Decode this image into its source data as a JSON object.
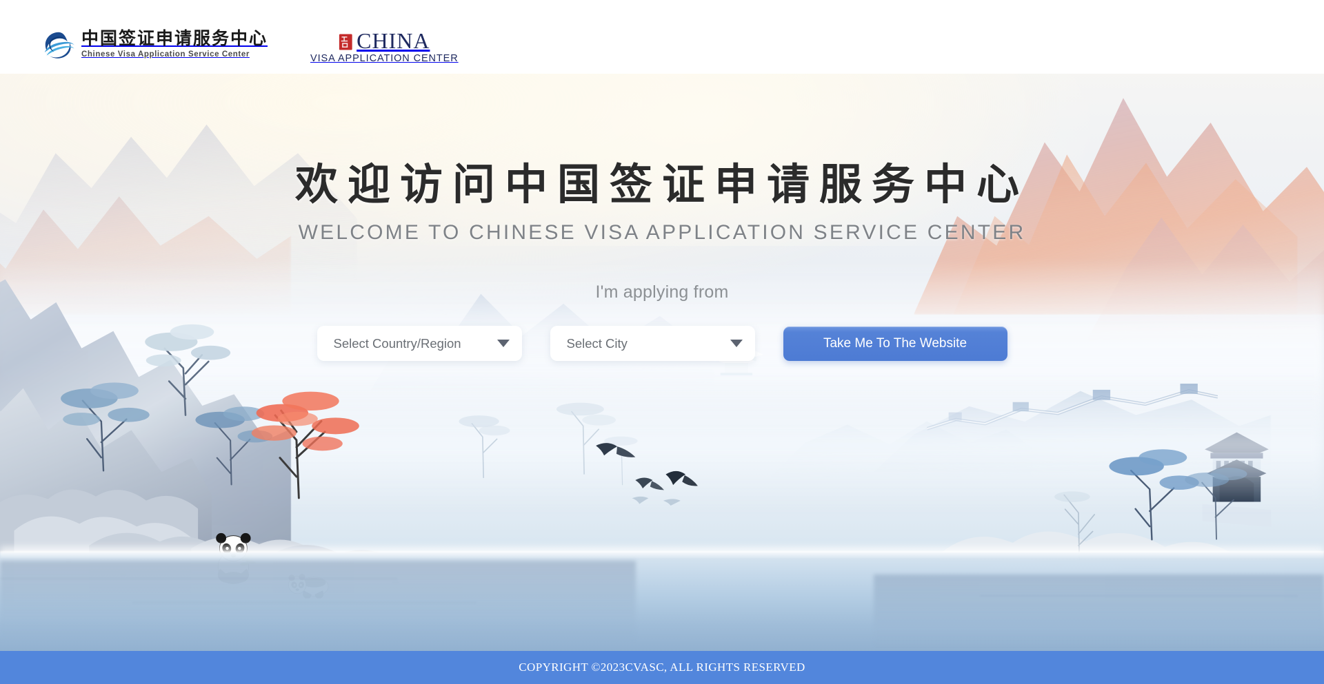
{
  "header": {
    "logo_primary": {
      "icon": "globe-swoosh-icon",
      "chinese_name": "中国签证申请服务中心",
      "english_name": "Chinese Visa Application Service Center"
    },
    "logo_secondary": {
      "icon": "china-seal-icon",
      "wordmark": "CHINA",
      "subtitle": "VISA APPLICATION CENTER"
    }
  },
  "hero": {
    "title_cn": "欢迎访问中国签证申请服务中心",
    "title_en": "WELCOME TO CHINESE VISA APPLICATION SERVICE CENTER",
    "prompt": "I'm applying from",
    "country_select": {
      "value": "Select Country/Region",
      "placeholder": "Select Country/Region",
      "caret_icon": "chevron-down-icon"
    },
    "city_select": {
      "value": "Select City",
      "placeholder": "Select City",
      "caret_icon": "chevron-down-icon"
    },
    "submit_label": "Take Me To The Website"
  },
  "footer": {
    "copyright": "COPYRIGHT ©2023CVASC, ALL RIGHTS RESERVED"
  },
  "colors": {
    "accent_blue": "#5286dc",
    "button_blue": "#5582d7",
    "logo_navy": "#1f2a60",
    "logo_cyan": "#3b9ad6",
    "seal_red": "#c42b2b",
    "text_muted": "#8c9094"
  },
  "background": {
    "scene": "chinese-ink-landscape",
    "elements": [
      "mountains",
      "great-wall",
      "pagoda",
      "pine-trees",
      "red-maple",
      "pandas",
      "lake",
      "flying-birds",
      "mist"
    ]
  }
}
